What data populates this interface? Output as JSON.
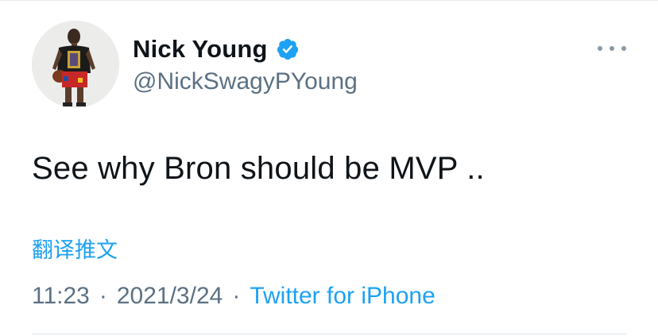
{
  "user": {
    "display_name": "Nick Young",
    "handle": "@NickSwagyPYoung",
    "verified": true
  },
  "tweet": {
    "text": "See why Bron should be MVP ..",
    "translate_label": "翻译推文",
    "time": "11:23",
    "separator": "·",
    "date": "2021/3/24",
    "source": "Twitter for iPhone"
  },
  "icons": {
    "verified": "verified-badge-icon",
    "more": "more-options-icon"
  },
  "colors": {
    "accent": "#1da1f2",
    "text": "#0f1419",
    "secondary": "#5b7083"
  }
}
